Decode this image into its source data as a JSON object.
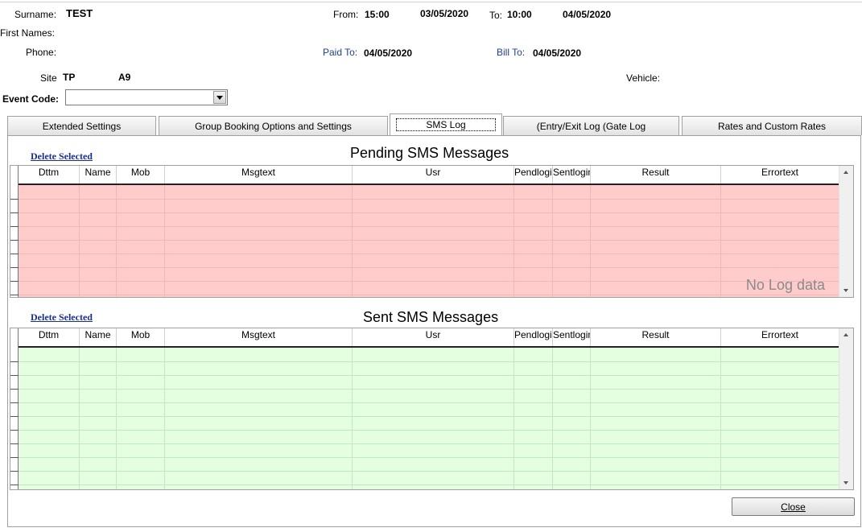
{
  "booking": {
    "surname_label": "Surname:",
    "surname": "TEST",
    "first_names_label": "First Names:",
    "phone_label": "Phone:",
    "from_label": "From:",
    "from_time": "15:00",
    "from_date": "03/05/2020",
    "to_label": "To:",
    "to_time": "10:00",
    "to_date": "04/05/2020",
    "paid_to_label": "Paid To:",
    "paid_to": "04/05/2020",
    "bill_to_label": "Bill To:",
    "bill_to": "04/05/2020",
    "site_label": "Site",
    "site_code": "TP",
    "site_number": "A9",
    "vehicle_label": "Vehicle:",
    "event_code_label": "Event Code:",
    "event_code_value": ""
  },
  "tabs": [
    {
      "label": "Extended Settings"
    },
    {
      "label": "Group Booking Options and Settings"
    },
    {
      "label": "SMS Log"
    },
    {
      "label": "(Entry/Exit Log (Gate Log"
    },
    {
      "label": "Rates and Custom Rates"
    }
  ],
  "pending": {
    "delete_label": "Delete Selected",
    "title": "Pending SMS Messages",
    "empty_text": "No Log data",
    "row_color": "#ffcccc",
    "line_color": "#f6b4b4"
  },
  "sent": {
    "delete_label": "Delete Selected",
    "title": "Sent SMS Messages",
    "row_color": "#e3ffe0",
    "line_color": "#c3e8bf"
  },
  "columns": [
    "Dttm",
    "Name",
    "Mob",
    "Msgtext",
    "Usr",
    "Pendlogin",
    "Sentlogin",
    "Result",
    "Errortext"
  ],
  "close_label": "Close",
  "colors": {
    "link": "#1a2f8a",
    "field_label_blue": "#1f3f8f"
  }
}
